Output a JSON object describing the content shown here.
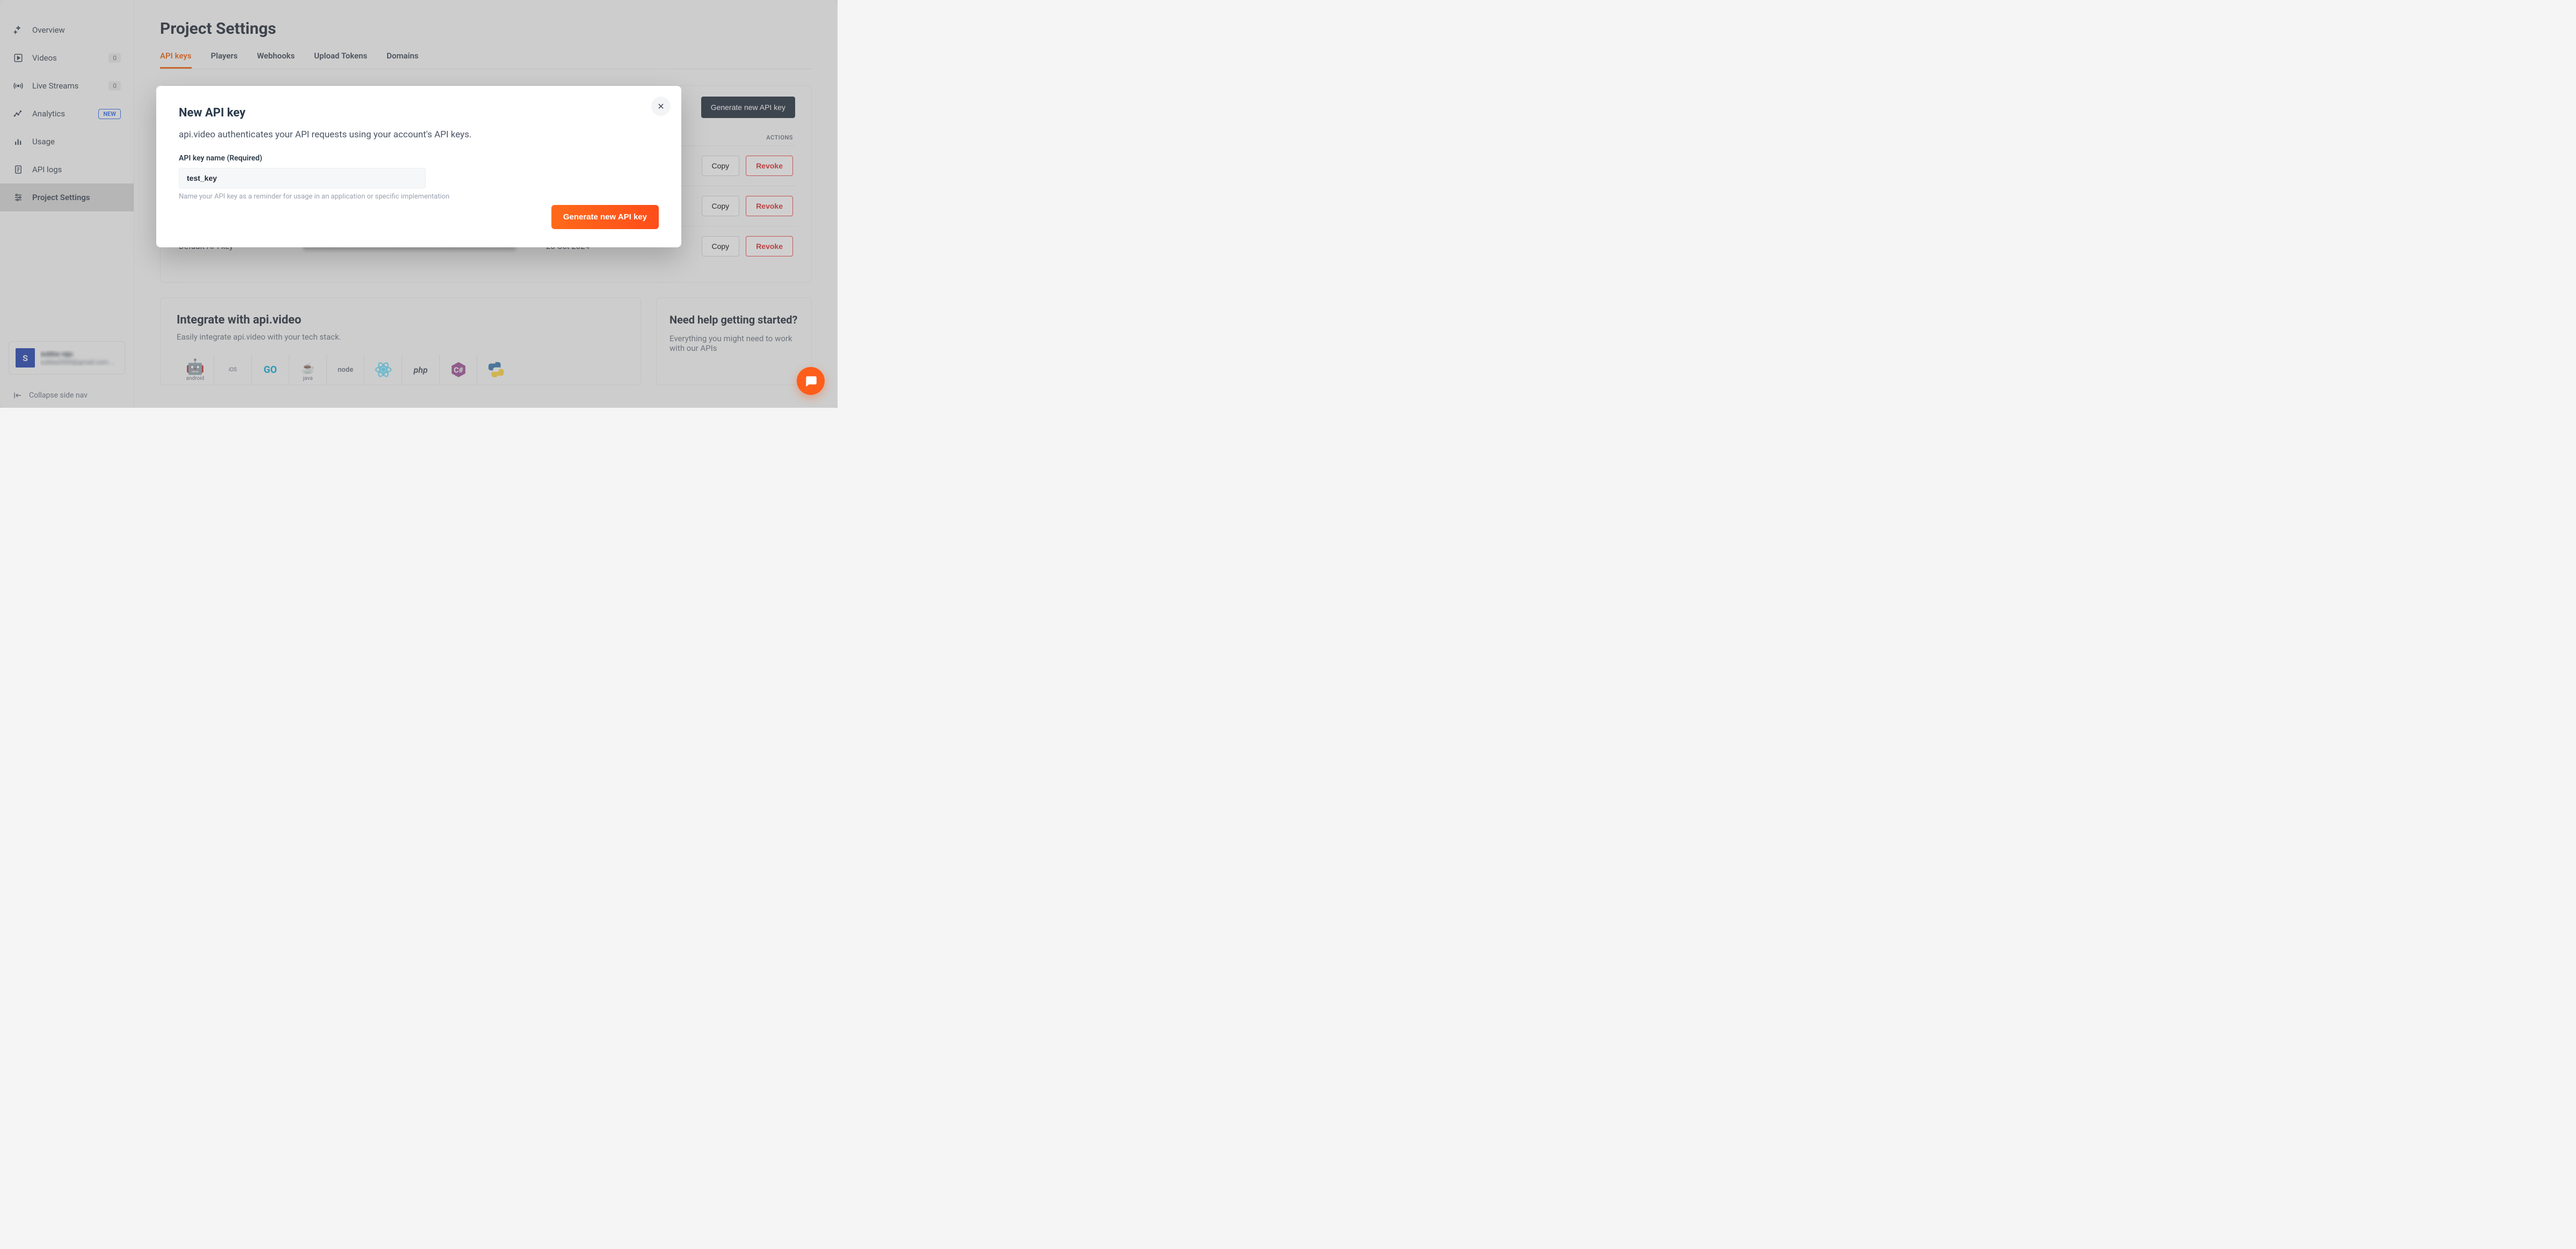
{
  "sidebar": {
    "items": [
      {
        "label": "Overview"
      },
      {
        "label": "Videos",
        "count": "0"
      },
      {
        "label": "Live Streams",
        "count": "0"
      },
      {
        "label": "Analytics",
        "badge": "NEW"
      },
      {
        "label": "Usage"
      },
      {
        "label": "API logs"
      },
      {
        "label": "Project Settings"
      }
    ],
    "user": {
      "initial": "S",
      "name": "subba raju",
      "email": "subba2000@gmail.com ..."
    },
    "collapse": "Collapse side nav"
  },
  "page": {
    "title": "Project Settings"
  },
  "tabs": [
    "API keys",
    "Players",
    "Webhooks",
    "Upload Tokens",
    "Domains"
  ],
  "keys_card": {
    "generate_label": "Generate new API key",
    "col_actions": "ACTIONS",
    "rows": [
      {
        "name": "",
        "date": "",
        "copy": "Copy",
        "revoke": "Revoke"
      },
      {
        "name": "",
        "date": "",
        "copy": "Copy",
        "revoke": "Revoke"
      },
      {
        "name": "Default API key",
        "date": "28 Oct 2024",
        "copy": "Copy",
        "revoke": "Revoke"
      }
    ]
  },
  "integrate": {
    "title": "Integrate with api.video",
    "subtitle": "Easily integrate api.video with your tech stack.",
    "techs": [
      "android",
      "iOS",
      "GO",
      "java",
      "node",
      "react",
      "php",
      "C#",
      "python"
    ]
  },
  "help": {
    "title": "Need help getting started?",
    "text": "Everything you might need to work with our APIs"
  },
  "modal": {
    "title": "New API key",
    "desc": "api.video authenticates your API requests using your account's API keys.",
    "field_label": "API key name (Required)",
    "field_value": "test_key",
    "hint": "Name your API key as a reminder for usage in an application or specific implementation",
    "submit": "Generate new API key"
  }
}
